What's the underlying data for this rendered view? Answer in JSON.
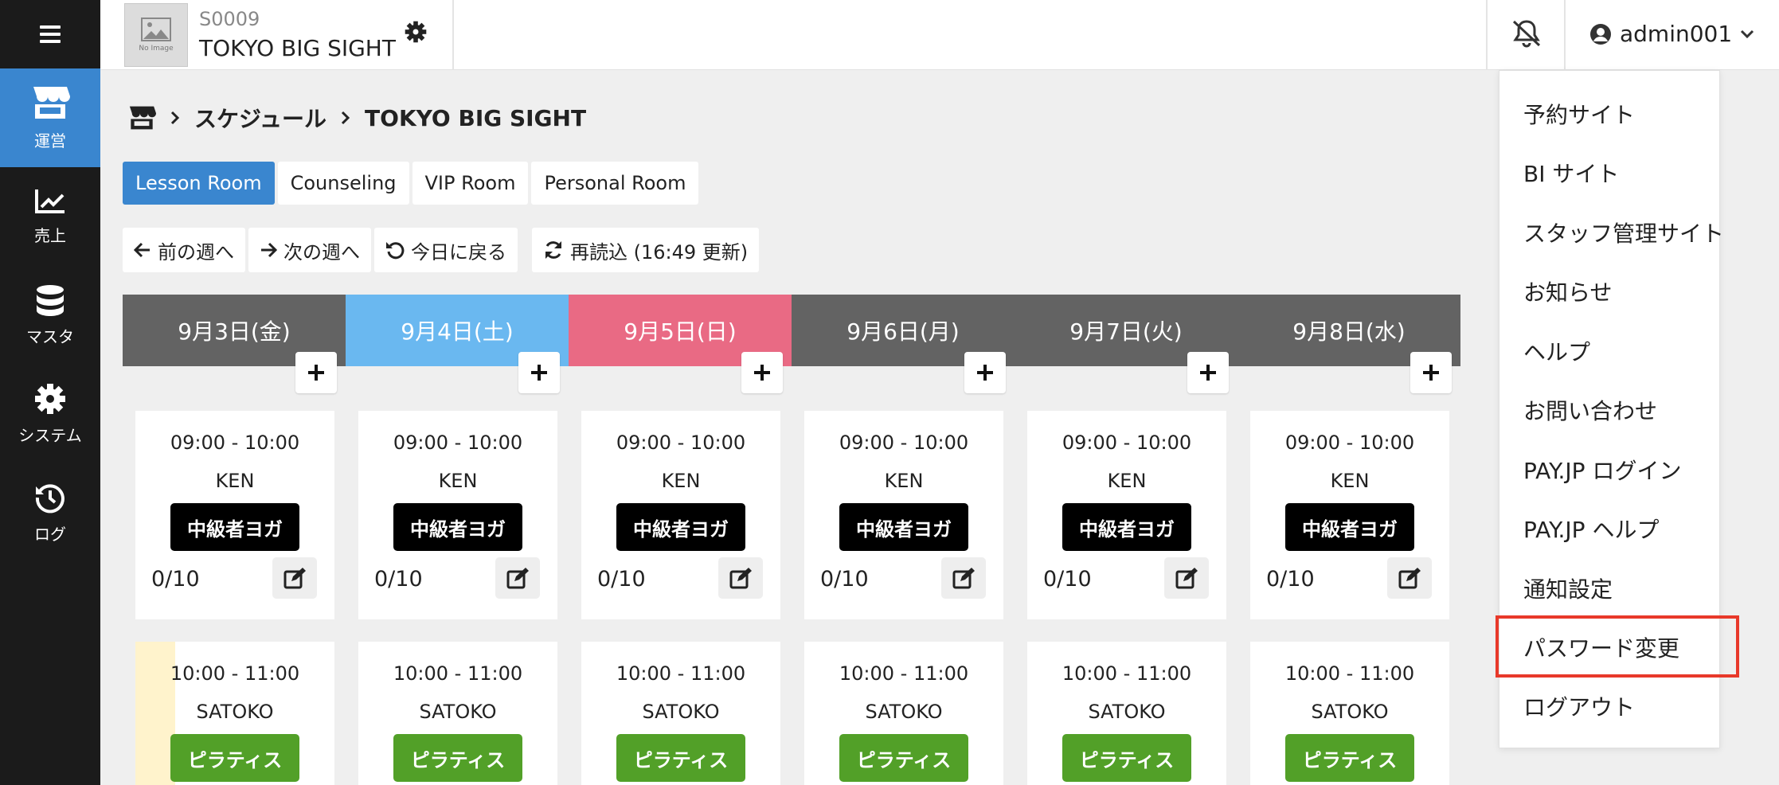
{
  "sidebar": {
    "items": [
      {
        "label": "運営",
        "icon": "store-icon",
        "active": true
      },
      {
        "label": "売上",
        "icon": "chart-line-icon",
        "active": false
      },
      {
        "label": "マスタ",
        "icon": "database-icon",
        "active": false
      },
      {
        "label": "システム",
        "icon": "gear-icon",
        "active": false
      },
      {
        "label": "ログ",
        "icon": "history-icon",
        "active": false
      }
    ]
  },
  "header": {
    "logo_placeholder": "No Image",
    "store_code": "S0009",
    "store_name": "TOKYO BIG SIGHT",
    "user": "admin001"
  },
  "breadcrumb": {
    "items": [
      "スケジュール",
      "TOKYO BIG SIGHT"
    ]
  },
  "rooms": {
    "tabs": [
      "Lesson Room",
      "Counseling",
      "VIP Room",
      "Personal Room"
    ],
    "active": "Lesson Room"
  },
  "nav": {
    "prev_week": "前の週へ",
    "next_week": "次の週へ",
    "today": "今日に戻る",
    "reload": "再読込 (16:49 更新)"
  },
  "colors": {
    "accent": "#3a86cf",
    "weekday": "#636363",
    "saturday": "#6ab8f0",
    "sunday": "#e96a84",
    "lesson_yoga": "#000000",
    "lesson_pilates": "#52a028",
    "highlight": "#e8392a"
  },
  "days": [
    {
      "label": "9月3日(金)",
      "type": "weekday"
    },
    {
      "label": "9月4日(土)",
      "type": "saturday"
    },
    {
      "label": "9月5日(日)",
      "type": "sunday"
    },
    {
      "label": "9月6日(月)",
      "type": "weekday"
    },
    {
      "label": "9月7日(火)",
      "type": "weekday"
    },
    {
      "label": "9月8日(水)",
      "type": "weekday"
    }
  ],
  "slots": [
    {
      "time": "09:00 - 10:00",
      "staff": "KEN",
      "lesson": "中級者ヨガ",
      "count": "0/10",
      "lesson_color": "yoga"
    },
    {
      "time": "10:00 - 11:00",
      "staff": "SATOKO",
      "lesson": "ピラティス",
      "count": "",
      "lesson_color": "pilates"
    }
  ],
  "user_menu": {
    "items": [
      "予約サイト",
      "BI サイト",
      "スタッフ管理サイト",
      "お知らせ",
      "ヘルプ",
      "お問い合わせ",
      "PAY.JP ログイン",
      "PAY.JP ヘルプ",
      "通知設定",
      "パスワード変更",
      "ログアウト"
    ],
    "highlighted": "パスワード変更"
  }
}
